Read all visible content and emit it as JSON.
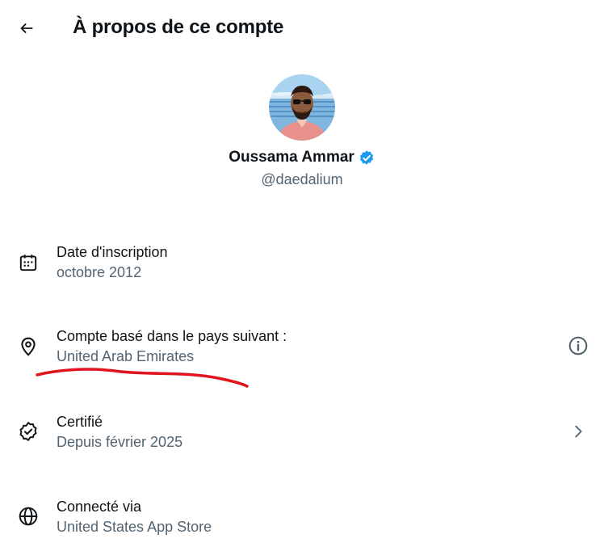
{
  "header": {
    "title": "À propos de ce compte",
    "back_icon": "arrow-left-icon"
  },
  "profile": {
    "display_name": "Oussama Ammar",
    "handle": "@daedalium",
    "verified": true,
    "verified_color": "#1d9bf0",
    "avatar_icon": "cartoon-avatar-image"
  },
  "rows": [
    {
      "icon": "calendar-icon",
      "label": "Date d'inscription",
      "value": "octobre 2012"
    },
    {
      "icon": "location-pin-icon",
      "label": "Compte basé dans le pays suivant :",
      "value": "United Arab Emirates",
      "trailing_icon": "info-icon"
    },
    {
      "icon": "verified-badge-outline-icon",
      "label": "Certifié",
      "value": "Depuis février 2025",
      "trailing_icon": "chevron-right-icon"
    },
    {
      "icon": "globe-icon",
      "label": "Connecté via",
      "value": "United States App Store"
    }
  ],
  "annotation": {
    "type": "hand-drawn-underline",
    "color": "#e0141e"
  },
  "colors": {
    "text_primary": "#0f1419",
    "text_secondary": "#536471",
    "background": "#ffffff"
  }
}
